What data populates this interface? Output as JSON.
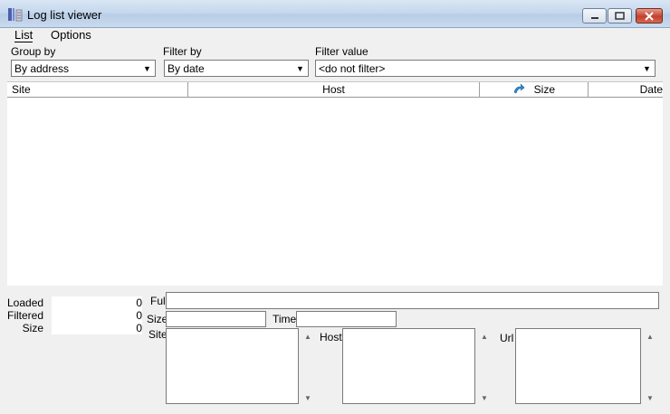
{
  "window": {
    "title": "Log list viewer"
  },
  "menu": {
    "list": "List",
    "options": "Options"
  },
  "filters": {
    "group_by_label": "Group by",
    "group_by_value": "By address",
    "filter_by_label": "Filter by",
    "filter_by_value": "By date",
    "filter_value_label": "Filter value",
    "filter_value_value": "<do not filter>"
  },
  "list": {
    "columns": [
      "Site",
      "Host",
      "Size",
      "Date"
    ],
    "rows": []
  },
  "stats": {
    "loaded_label": "Loaded",
    "loaded_value": "0",
    "filtered_label": "Filtered",
    "filtered_value": "0",
    "size_label": "Size",
    "size_value": "0"
  },
  "details": {
    "full_label": "Full",
    "size_label": "Size",
    "time_label": "Time",
    "site_label": "Site",
    "host_label": "Host",
    "url_label": "Url"
  },
  "icons": {
    "app": "app-icon",
    "sort": "sort-ascending-icon"
  }
}
